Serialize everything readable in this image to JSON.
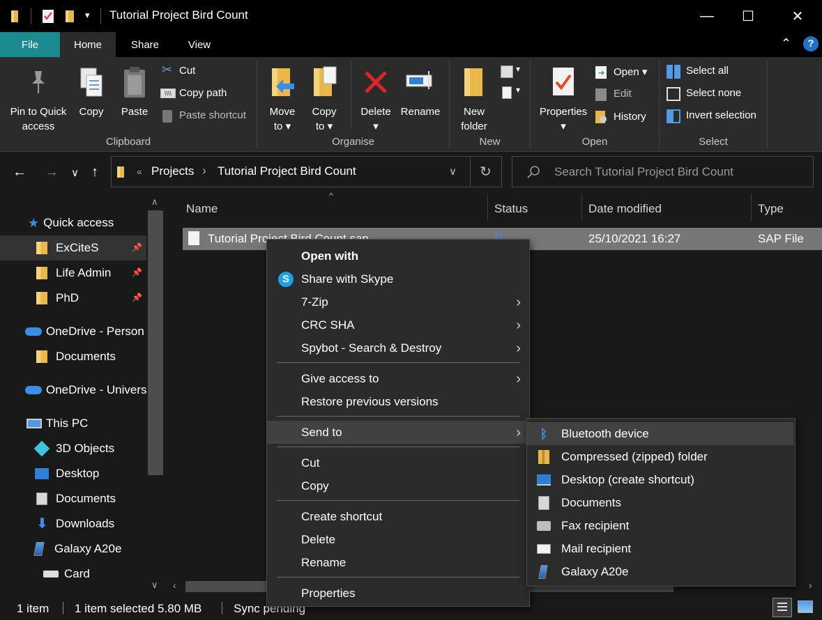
{
  "window": {
    "title": "Tutorial Project Bird Count",
    "minimize": "—",
    "maximize": "☐",
    "close": "✕"
  },
  "tabs": [
    {
      "label": "File"
    },
    {
      "label": "Home"
    },
    {
      "label": "Share"
    },
    {
      "label": "View"
    }
  ],
  "ribbon": {
    "pin_l1": "Pin to Quick",
    "pin_l2": "access",
    "copy": "Copy",
    "paste": "Paste",
    "cut": "Cut",
    "copy_path": "Copy path",
    "paste_shortcut": "Paste shortcut",
    "move_l1": "Move",
    "move_l2": "to ▾",
    "copyto_l1": "Copy",
    "copyto_l2": "to ▾",
    "delete_l1": "Delete",
    "delete_l2": "▾",
    "rename": "Rename",
    "newfolder_l1": "New",
    "newfolder_l2": "folder",
    "properties_l1": "Properties",
    "properties_l2": "▾",
    "open": "Open ▾",
    "edit": "Edit",
    "history": "History",
    "select_all": "Select all",
    "select_none": "Select none",
    "invert_selection": "Invert selection",
    "groups": {
      "clipboard": "Clipboard",
      "organise": "Organise",
      "new": "New",
      "open": "Open",
      "select": "Select"
    }
  },
  "address": {
    "chevrons": "«",
    "crumb1": "Projects",
    "sep": "›",
    "crumb2": "Tutorial Project Bird Count",
    "search_placeholder": "Search Tutorial Project Bird Count"
  },
  "sidebar": {
    "quick_access": "Quick access",
    "items": [
      {
        "label": "ExCiteS"
      },
      {
        "label": "Life Admin"
      },
      {
        "label": "PhD"
      },
      {
        "label": "OneDrive - Person"
      },
      {
        "label": "Documents"
      },
      {
        "label": "OneDrive - Univers"
      },
      {
        "label": "This PC"
      },
      {
        "label": "3D Objects"
      },
      {
        "label": "Desktop"
      },
      {
        "label": "Documents"
      },
      {
        "label": "Downloads"
      },
      {
        "label": "Galaxy A20e"
      },
      {
        "label": "Card"
      }
    ]
  },
  "filelist": {
    "columns": [
      "Name",
      "Status",
      "Date modified",
      "Type"
    ],
    "row": {
      "name": "Tutorial Project Bird Count.sap",
      "date": "25/10/2021 16:27",
      "type": "SAP File"
    }
  },
  "statusbar": {
    "count": "1 item",
    "selected": "1 item selected  5.80 MB",
    "sync": "Sync pending"
  },
  "context_menu": {
    "open_with": "Open with",
    "share_skype": "Share with Skype",
    "zip": "7-Zip",
    "crc": "CRC SHA",
    "spybot": "Spybot - Search & Destroy",
    "give_access": "Give access to",
    "restore": "Restore previous versions",
    "send_to": "Send to",
    "cut": "Cut",
    "copy": "Copy",
    "create_shortcut": "Create shortcut",
    "delete": "Delete",
    "rename": "Rename",
    "properties": "Properties",
    "arrow": "›"
  },
  "send_to_menu": [
    {
      "label": "Bluetooth device"
    },
    {
      "label": "Compressed (zipped) folder"
    },
    {
      "label": "Desktop (create shortcut)"
    },
    {
      "label": "Documents"
    },
    {
      "label": "Fax recipient"
    },
    {
      "label": "Mail recipient"
    },
    {
      "label": "Galaxy A20e"
    }
  ]
}
